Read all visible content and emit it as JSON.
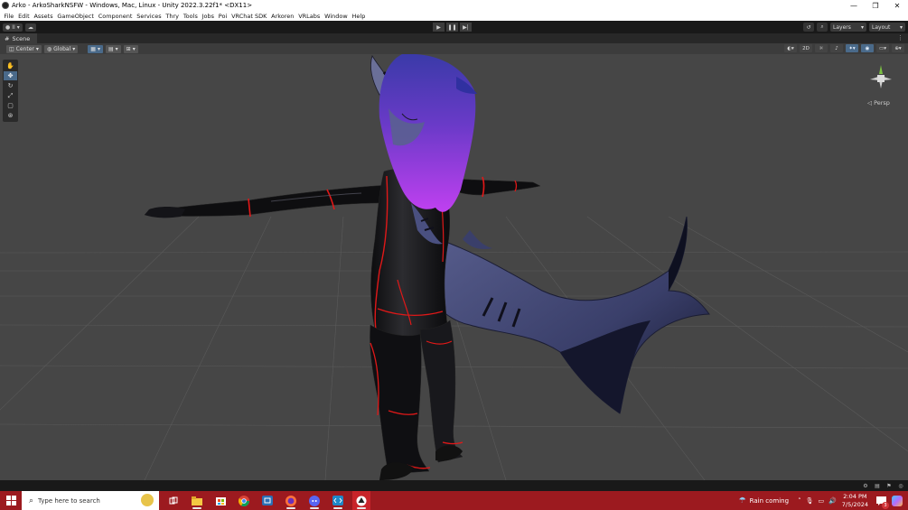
{
  "window": {
    "title": "Arko - ArkoSharkNSFW - Windows, Mac, Linux - Unity 2022.3.22f1* <DX11>",
    "controls": [
      "—",
      "❐",
      "✕"
    ]
  },
  "menu": [
    "File",
    "Edit",
    "Assets",
    "GameObject",
    "Component",
    "Services",
    "Thry",
    "Tools",
    "Jobs",
    "Poi",
    "VRChat SDK",
    "Arkoren",
    "VRLabs",
    "Window",
    "Help"
  ],
  "toolbar": {
    "account_label": "II",
    "play_icons": [
      "▶",
      "❚❚",
      "▶|"
    ],
    "layers_label": "Layers",
    "layout_label": "Layout"
  },
  "scene_tab": {
    "label": "Scene",
    "pivot_label": "Center",
    "space_label": "Global",
    "mode_2d_label": "2D"
  },
  "viewport": {
    "projection_label": "◁ Persp",
    "background_color": "#464646",
    "selection_color": "#e01818",
    "hair_color": "#b030e0"
  },
  "taskbar": {
    "search_placeholder": "Type here to search",
    "weather_text": "Rain coming",
    "time": "2:04 PM",
    "date": "7/5/2024",
    "notification_count": "3"
  }
}
